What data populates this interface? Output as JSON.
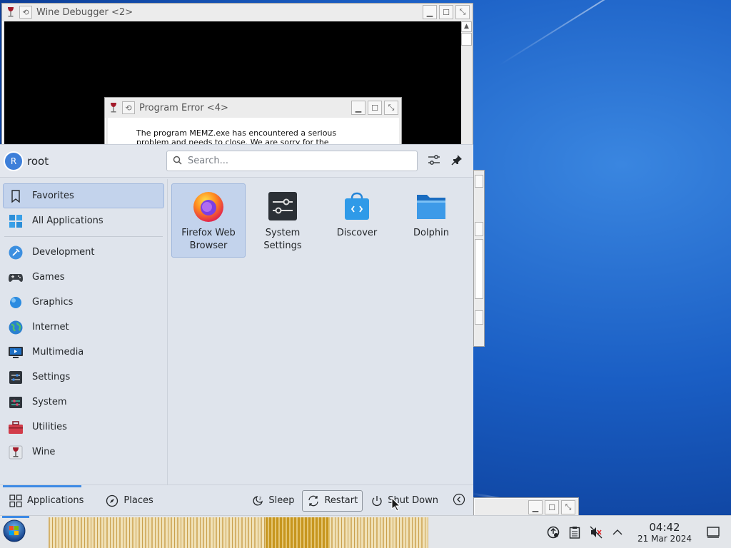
{
  "wine_debugger": {
    "title": "Wine Debugger <2>"
  },
  "program_error": {
    "title": "Program Error <4>",
    "message_line1": "The program MEMZ.exe has encountered a serious",
    "message_line2": "problem and needs to close. We are sorry for the"
  },
  "launcher": {
    "avatar_initial": "R",
    "username": "root",
    "search_placeholder": "Search...",
    "categories": [
      {
        "label": "Favorites",
        "icon": "bookmark-icon"
      },
      {
        "label": "All Applications",
        "icon": "grid-icon"
      },
      {
        "label": "Development",
        "icon": "hammer-icon"
      },
      {
        "label": "Games",
        "icon": "gamepad-icon"
      },
      {
        "label": "Graphics",
        "icon": "graphics-icon"
      },
      {
        "label": "Internet",
        "icon": "globe-icon"
      },
      {
        "label": "Multimedia",
        "icon": "multimedia-icon"
      },
      {
        "label": "Settings",
        "icon": "settings-icon"
      },
      {
        "label": "System",
        "icon": "system-icon"
      },
      {
        "label": "Utilities",
        "icon": "toolbox-icon"
      },
      {
        "label": "Wine",
        "icon": "wine-icon"
      }
    ],
    "apps": [
      {
        "line1": "Firefox Web",
        "line2": "Browser"
      },
      {
        "line1": "System",
        "line2": "Settings"
      },
      {
        "line1": "Discover",
        "line2": ""
      },
      {
        "line1": "Dolphin",
        "line2": ""
      }
    ],
    "footer": {
      "applications": "Applications",
      "places": "Places",
      "sleep": "Sleep",
      "restart": "Restart",
      "shutdown": "Shut Down"
    }
  },
  "taskbar": {
    "time": "04:42",
    "date": "21 Mar 2024"
  },
  "colors": {
    "accent": "#3d8ae5",
    "selection": "#c3d3ec",
    "menu_bg": "#dfe4ec"
  }
}
